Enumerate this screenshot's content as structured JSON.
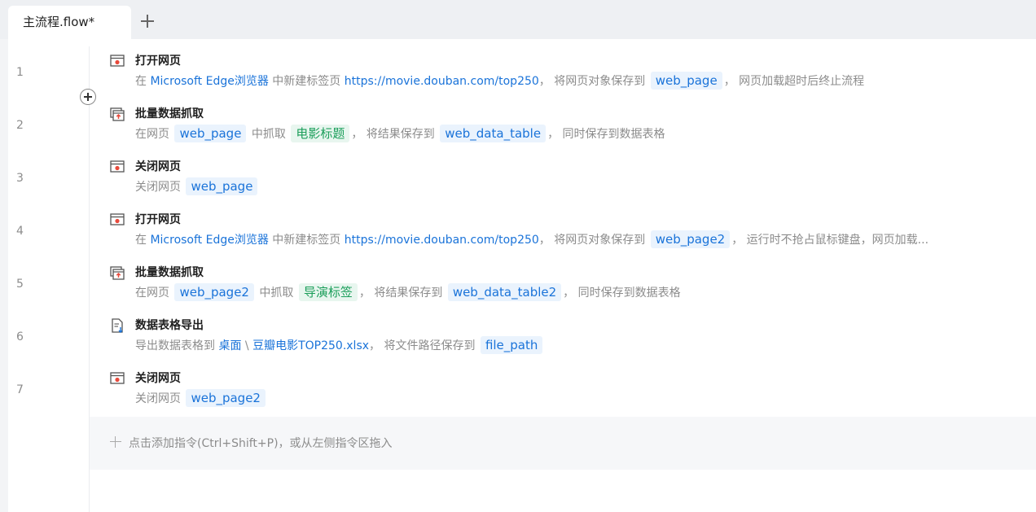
{
  "tab": {
    "label": "主流程.flow*"
  },
  "lines": [
    "1",
    "2",
    "3",
    "4",
    "5",
    "6",
    "7"
  ],
  "steps": [
    {
      "icon": "web-open-icon",
      "title": "打开网页",
      "p1": "在 ",
      "browser": "Microsoft Edge浏览器",
      "p2": " 中新建标签页 ",
      "url": "https://movie.douban.com/top250",
      "p3": "， 将网页对象保存到 ",
      "var": "web_page",
      "p4": "， 网页加载超时后终止流程"
    },
    {
      "icon": "data-scrape-icon",
      "title": "批量数据抓取",
      "p1": "在网页 ",
      "var1": "web_page",
      "p2": " 中抓取 ",
      "tag": "电影标题",
      "p3": "， 将结果保存到 ",
      "var2": "web_data_table",
      "p4": "， 同时保存到数据表格"
    },
    {
      "icon": "web-close-icon",
      "title": "关闭网页",
      "p1": "关闭网页 ",
      "var": "web_page"
    },
    {
      "icon": "web-open-icon",
      "title": "打开网页",
      "p1": "在 ",
      "browser": "Microsoft Edge浏览器",
      "p2": " 中新建标签页 ",
      "url": "https://movie.douban.com/top250",
      "p3": "， 将网页对象保存到 ",
      "var": "web_page2",
      "p4": "， 运行时不抢占鼠标键盘，网页加载..."
    },
    {
      "icon": "data-scrape-icon",
      "title": "批量数据抓取",
      "p1": "在网页 ",
      "var1": "web_page2",
      "p2": " 中抓取 ",
      "tag": "导演标签",
      "p3": "， 将结果保存到 ",
      "var2": "web_data_table2",
      "p4": "， 同时保存到数据表格"
    },
    {
      "icon": "excel-export-icon",
      "title": "数据表格导出",
      "p1": "导出数据表格到 ",
      "folder": "桌面",
      "sep": " \\ ",
      "file": "豆瓣电影TOP250.xlsx",
      "p2": "， 将文件路径保存到 ",
      "var": "file_path"
    },
    {
      "icon": "web-close-icon",
      "title": "关闭网页",
      "p1": "关闭网页 ",
      "var": "web_page2"
    }
  ],
  "add_bar": {
    "text": "点击添加指令(Ctrl+Shift+P)，或从左侧指令区拖入"
  }
}
